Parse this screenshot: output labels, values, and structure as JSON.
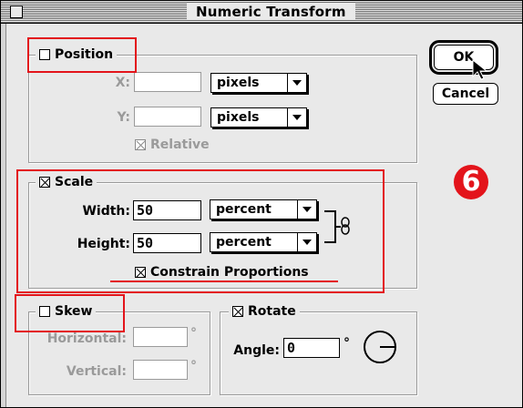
{
  "window": {
    "title": "Numeric Transform"
  },
  "buttons": {
    "ok": "OK",
    "cancel": "Cancel"
  },
  "position": {
    "label": "Position",
    "checked": false,
    "x_label": "X:",
    "y_label": "Y:",
    "x_value": "",
    "y_value": "",
    "x_unit": "pixels",
    "y_unit": "pixels",
    "relative_label": "Relative",
    "relative_checked": true
  },
  "scale": {
    "label": "Scale",
    "checked": true,
    "width_label": "Width:",
    "height_label": "Height:",
    "width_value": "50",
    "height_value": "50",
    "width_unit": "percent",
    "height_unit": "percent",
    "constrain_label": "Constrain Proportions",
    "constrain_checked": true
  },
  "skew": {
    "label": "Skew",
    "checked": false,
    "horizontal_label": "Horizontal:",
    "vertical_label": "Vertical:",
    "horizontal_value": "",
    "vertical_value": "",
    "degree_symbol": "°"
  },
  "rotate": {
    "label": "Rotate",
    "checked": true,
    "angle_label": "Angle:",
    "angle_value": "0",
    "degree_symbol": "°"
  },
  "annotation": {
    "step_number": "6",
    "color": "#e3141b"
  }
}
